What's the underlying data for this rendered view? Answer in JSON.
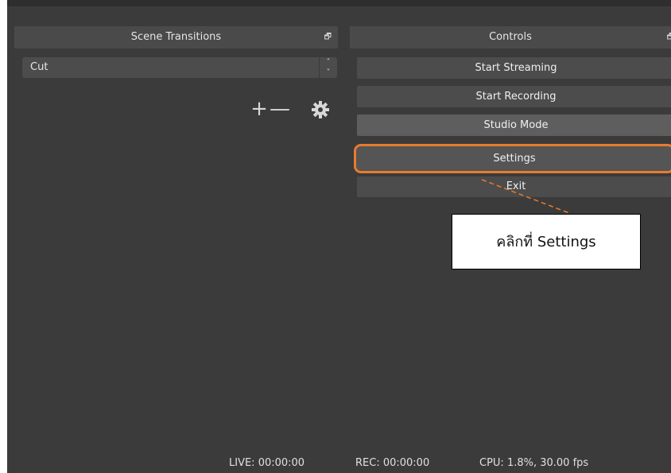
{
  "scene_transitions": {
    "title": "Scene Transitions",
    "float_icon": "float-icon",
    "transition_select": {
      "value": "Cut"
    },
    "tools": {
      "add": "+",
      "remove": "—"
    }
  },
  "controls": {
    "title": "Controls",
    "float_icon": "float-icon",
    "buttons": [
      {
        "label": "Start Streaming"
      },
      {
        "label": "Start Recording"
      },
      {
        "label": "Studio Mode"
      },
      {
        "label": "Settings"
      },
      {
        "label": "Exit"
      }
    ]
  },
  "status_bar": {
    "live": "LIVE: 00:00:00",
    "rec": "REC: 00:00:00",
    "cpu": "CPU: 1.8%, 30.00 fps"
  },
  "annotation": {
    "text": "คลิกที่ Settings",
    "highlight_color": "#e87c2e"
  }
}
